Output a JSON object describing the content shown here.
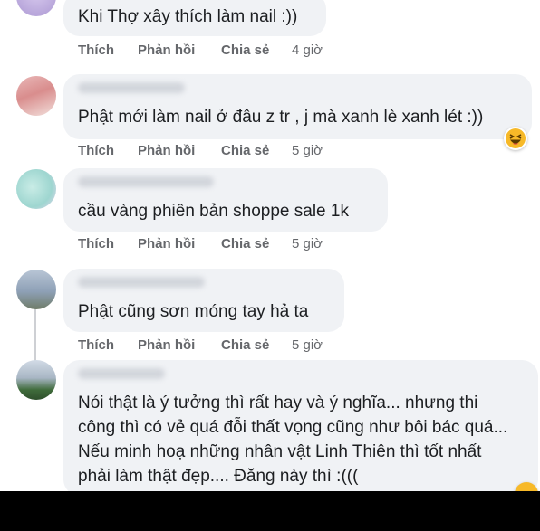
{
  "actions": {
    "like": "Thích",
    "reply": "Phản hồi",
    "share": "Chia sẻ"
  },
  "comments": [
    {
      "text": "Khi Thợ xây thích làm nail :))",
      "time": "4 giờ"
    },
    {
      "text": "Phật mới làm nail ở đâu z tr , j mà xanh lè xanh lét :))",
      "time": "5 giờ",
      "reaction": "haha-emoji-icon"
    },
    {
      "text": "cầu vàng phiên bản shoppe sale 1k",
      "time": "5 giờ"
    },
    {
      "text": "Phật cũng sơn móng tay hả ta",
      "time": "5 giờ"
    },
    {
      "lines": [
        "Nói thật là ý tưởng thì rất hay và ý nghĩa... nhưng thi",
        "công thì có vẻ quá đỗi thất vọng cũng như bôi bác quá...",
        "Nếu minh hoạ những nhân vật Linh Thiên thì tốt nhất",
        "phải làm thật đẹp.... Đăng này thì :((("
      ]
    }
  ],
  "colors": {
    "bubble": "#f0f2f5",
    "text": "#1c1e21",
    "meta": "#65676b",
    "haha": "#f7b928"
  }
}
